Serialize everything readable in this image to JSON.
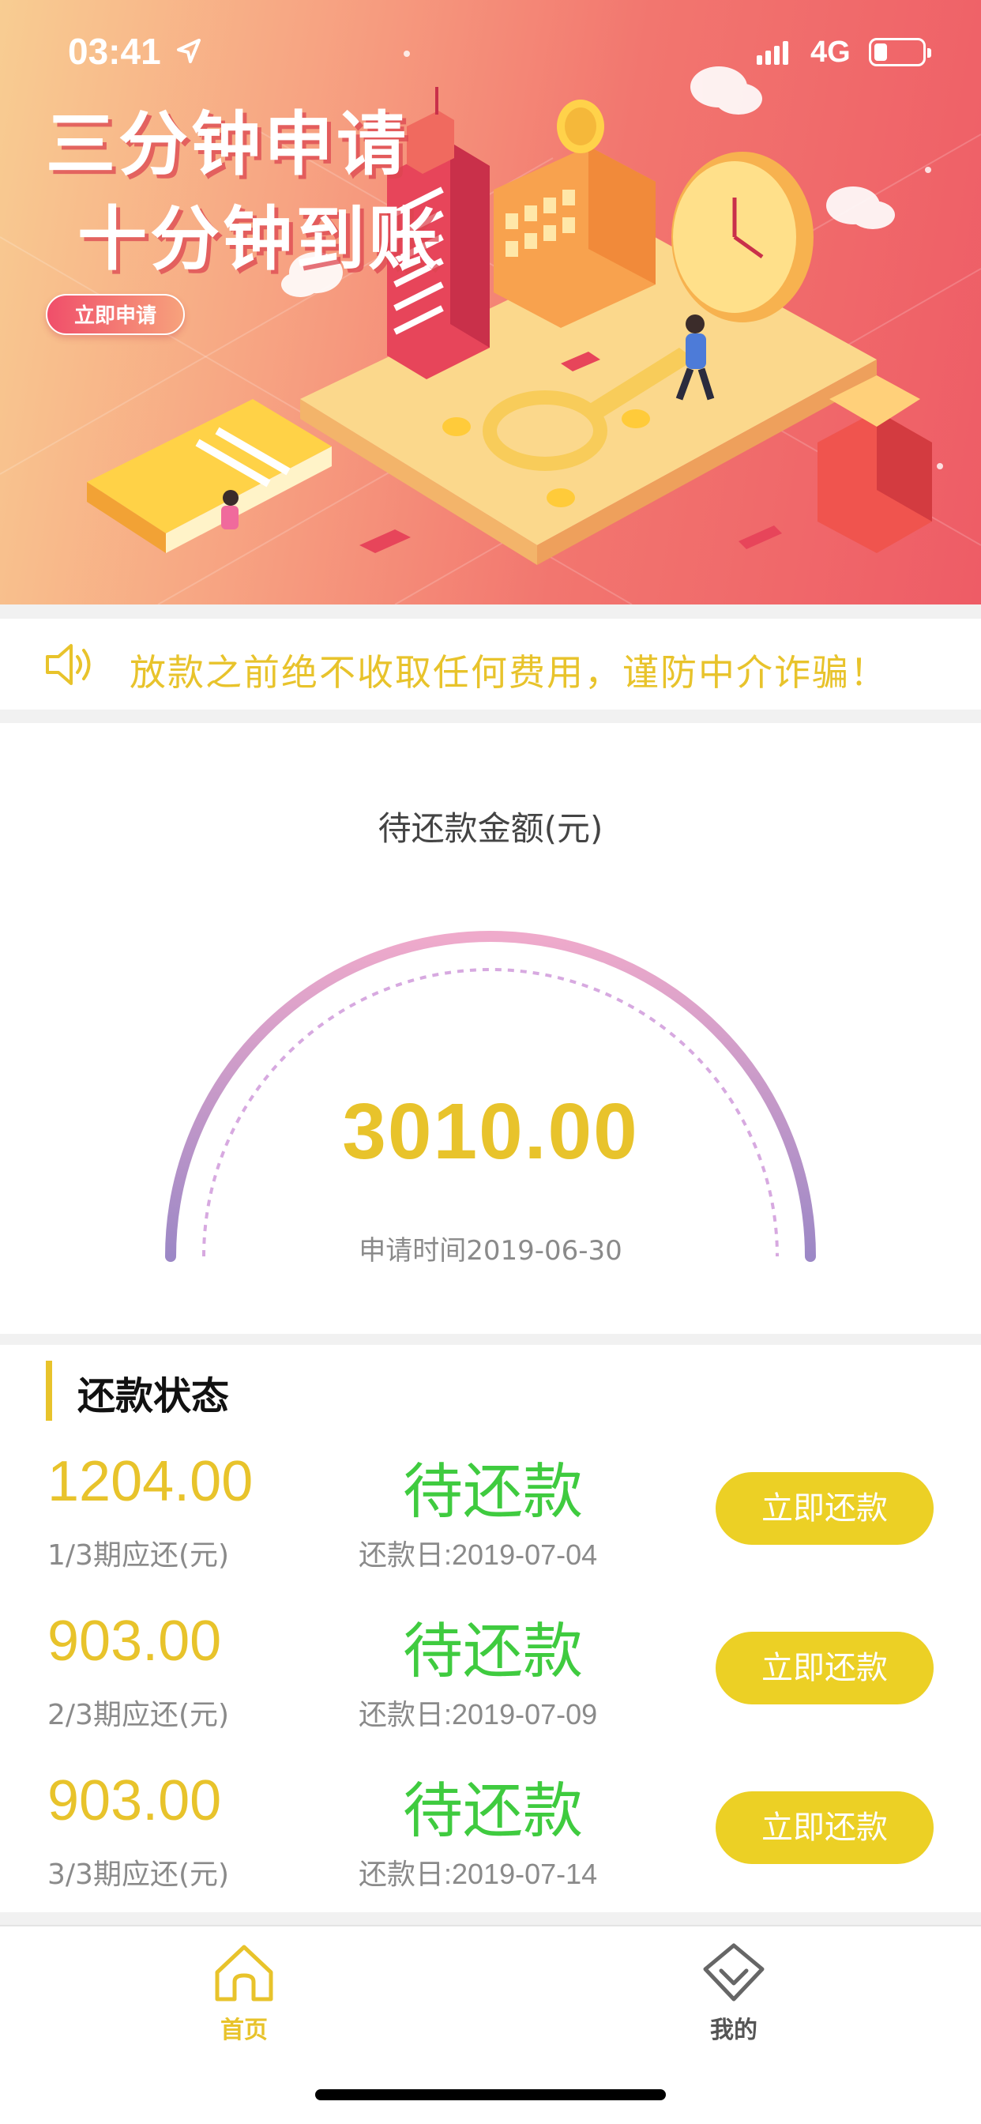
{
  "status_bar": {
    "time": "03:41",
    "network": "4G",
    "icons": [
      "location-arrow-icon",
      "signal-icon",
      "battery-icon"
    ]
  },
  "banner": {
    "title_line1": "三分钟申请",
    "title_line2": "十分钟到账",
    "apply_button": "立即申请"
  },
  "notice": {
    "icon": "speaker-icon",
    "text": "放款之前绝不收取任何费用，谨防中介诈骗！"
  },
  "amount": {
    "label": "待还款金额(元)",
    "value": "3010.00",
    "apply_time": "申请时间2019-06-30"
  },
  "repayment": {
    "title": "还款状态",
    "rows": [
      {
        "amount": "1204.00",
        "period": "1/3期应还(元)",
        "status": "待还款",
        "date": "还款日:2019-07-04",
        "button": "立即还款"
      },
      {
        "amount": "903.00",
        "period": "2/3期应还(元)",
        "status": "待还款",
        "date": "还款日:2019-07-09",
        "button": "立即还款"
      },
      {
        "amount": "903.00",
        "period": "3/3期应还(元)",
        "status": "待还款",
        "date": "还款日:2019-07-14",
        "button": "立即还款"
      }
    ]
  },
  "tabbar": {
    "home": {
      "label": "首页",
      "icon": "home-icon"
    },
    "mine": {
      "label": "我的",
      "icon": "diamond-icon"
    }
  },
  "colors": {
    "accent": "#e8c32b",
    "button": "#ecd025",
    "status_green": "#3fcb3f",
    "banner_start": "#f8cd92",
    "banner_end": "#ee5c66"
  }
}
